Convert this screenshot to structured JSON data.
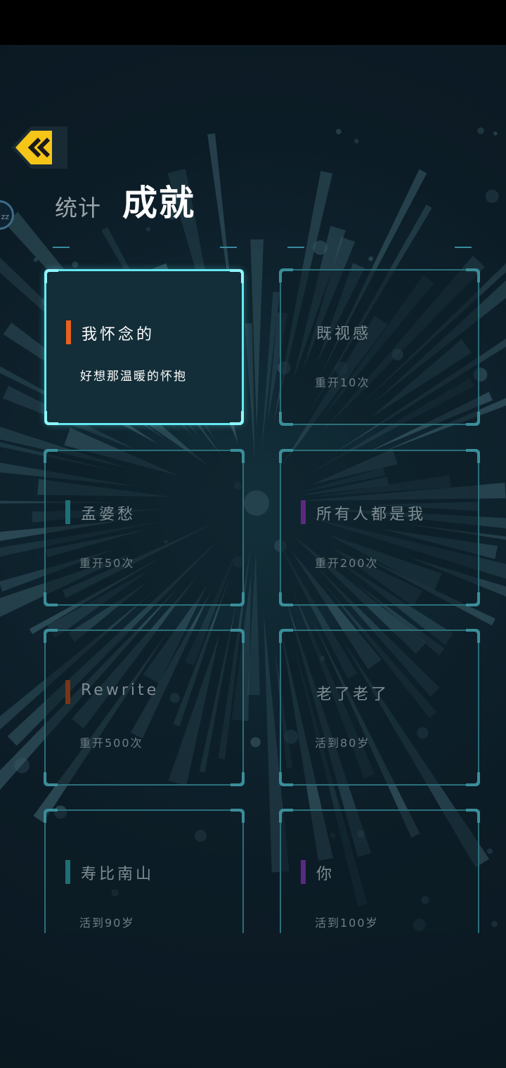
{
  "header": {
    "tab_stats": "统计",
    "tab_achievements": "成就",
    "side_badge": "zz"
  },
  "colors": {
    "background": "#0c1a23",
    "card_border": "#2b6f7a",
    "card_active_border": "#63e9f2",
    "back_button": "#f5c518"
  },
  "icons": {
    "back": "double-chevron-left-icon"
  },
  "achievements": [
    {
      "title": "我怀念的",
      "desc": "好想那温暖的怀抱",
      "accent": "#e8601c",
      "active": true
    },
    {
      "title": "既视感",
      "desc": "重开10次",
      "accent": "",
      "active": false
    },
    {
      "title": "孟婆愁",
      "desc": "重开50次",
      "accent": "#1f6f76",
      "active": false
    },
    {
      "title": "所有人都是我",
      "desc": "重开200次",
      "accent": "#5b2a80",
      "active": false
    },
    {
      "title": "Rewrite",
      "desc": "重开500次",
      "accent": "#7a3515",
      "active": false
    },
    {
      "title": "老了老了",
      "desc": "活到80岁",
      "accent": "",
      "active": false
    },
    {
      "title": "寿比南山",
      "desc": "活到90岁",
      "accent": "#1f6f76",
      "active": false
    },
    {
      "title": "你",
      "desc": "活到100岁",
      "accent": "#5b2a80",
      "active": false
    }
  ]
}
